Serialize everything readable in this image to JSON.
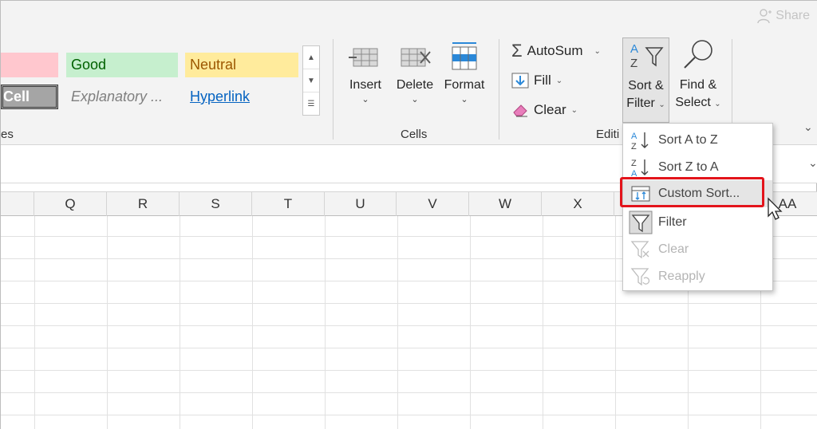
{
  "titlebar": {
    "share_label": "Share"
  },
  "styles_gallery": {
    "cells": [
      {
        "label": "Good",
        "bg": "#c6efce",
        "color": "#006100"
      },
      {
        "label": "Neutral",
        "bg": "#ffeb9c",
        "color": "#9c5700"
      },
      {
        "label": "Cell",
        "bg": "#a5a5a5",
        "color": "#ffffff"
      },
      {
        "label": "Explanatory ...",
        "bg": "#ffffff",
        "color": "#7f7f7f"
      },
      {
        "label": "Hyperlink",
        "bg": "#ffffff",
        "color": "#0563c1"
      }
    ],
    "bad_swatch_color": "#ffc7ce",
    "group_label": "es"
  },
  "cells_group": {
    "buttons": [
      {
        "label": "Insert",
        "icon": "insert-cells-icon"
      },
      {
        "label": "Delete",
        "icon": "delete-cells-icon"
      },
      {
        "label": "Format",
        "icon": "format-cells-icon"
      }
    ],
    "group_label": "Cells"
  },
  "editing_group": {
    "autosum_label": "AutoSum",
    "fill_label": "Fill",
    "clear_label": "Clear",
    "sort_filter_line1": "Sort &",
    "sort_filter_line2": "Filter",
    "find_select_line1": "Find &",
    "find_select_line2": "Select",
    "group_label": "Editi"
  },
  "columns": [
    "Q",
    "R",
    "S",
    "T",
    "U",
    "V",
    "W",
    "X",
    "AA"
  ],
  "sort_filter_menu": {
    "items": [
      {
        "label": "Sort A to Z",
        "icon": "sort-a-to-z-icon",
        "enabled": true
      },
      {
        "label": "Sort Z to A",
        "icon": "sort-z-to-a-icon",
        "enabled": true
      },
      {
        "label": "Custom Sort...",
        "icon": "custom-sort-icon",
        "enabled": true,
        "highlighted": true
      },
      {
        "label": "Filter",
        "icon": "filter-icon",
        "enabled": true
      },
      {
        "label": "Clear",
        "icon": "clear-filter-icon",
        "enabled": false
      },
      {
        "label": "Reapply",
        "icon": "reapply-filter-icon",
        "enabled": false
      }
    ],
    "highlight_color": "#e3141b"
  },
  "accent_color": "#2b88d8"
}
